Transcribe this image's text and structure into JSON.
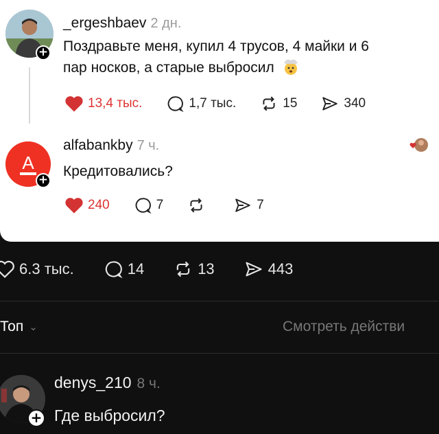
{
  "post": {
    "username": "_ergeshbaev",
    "time": "2 дн.",
    "text_line1": "Поздравьте меня, купил 4 трусов, 4 майки и 6",
    "text_line2": "пар носков, а старые выбросил",
    "emoji": "exploding-head",
    "likes": "13,4 тыс.",
    "comments": "1,7 тыс.",
    "reposts": "15",
    "shares": "340"
  },
  "reply": {
    "username": "alfabankby",
    "time": "7 ч.",
    "text": "Кредитовались?",
    "avatar_letter": "А",
    "likes": "240",
    "comments": "7",
    "reposts": "",
    "shares": "7"
  },
  "outer_stats": {
    "likes": "6.3 тыс.",
    "comments": "14",
    "reposts": "13",
    "shares": "443"
  },
  "sort": {
    "label": "Топ",
    "activity_link": "Смотреть действи"
  },
  "comment": {
    "username": "denys_210",
    "time": "8 ч.",
    "text": "Где выбросил?"
  },
  "colors": {
    "like_red": "#d33333",
    "alfa_red": "#ef3124",
    "dark_bg": "#101010"
  }
}
